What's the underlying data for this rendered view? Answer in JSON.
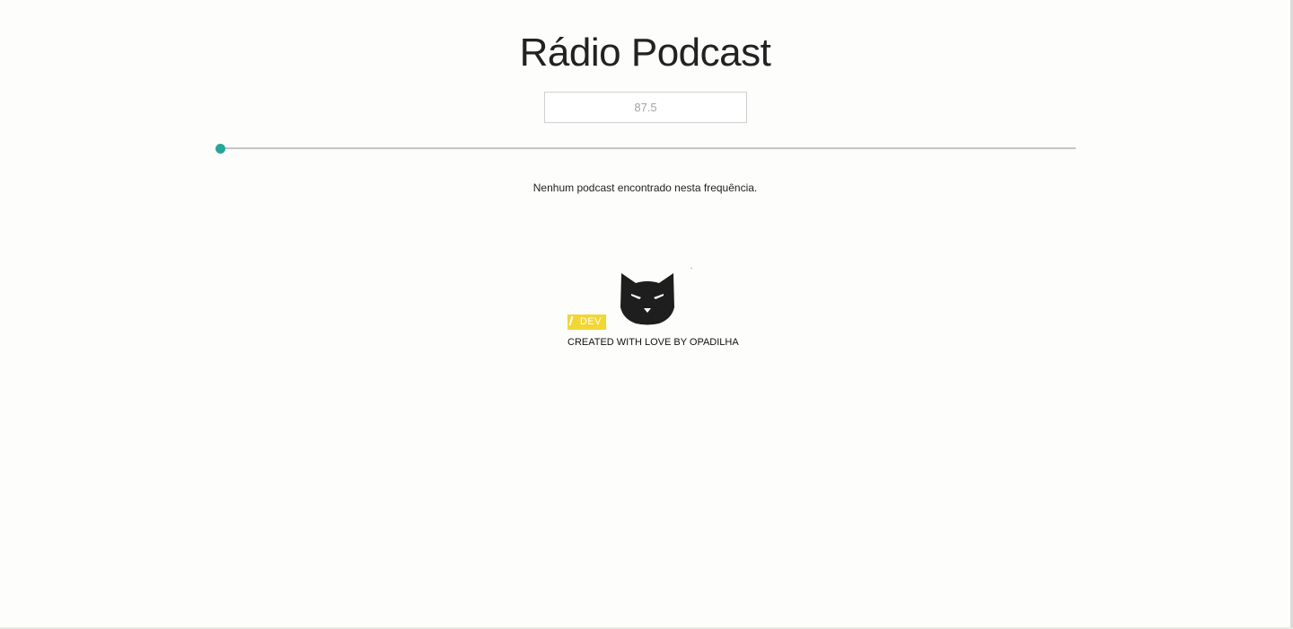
{
  "page": {
    "title": "Rádio Podcast"
  },
  "frequency": {
    "placeholder": "87.5",
    "value": ""
  },
  "slider": {
    "value_fraction": 0.0,
    "accent_color": "#26a69a",
    "track_color": "#c4c4c4"
  },
  "results": {
    "empty_message": "Nenhum podcast encontrado nesta frequência."
  },
  "footer": {
    "badge_text": "DEV",
    "badge_color": "#f2d634",
    "logo_icon": "cat-head-icon",
    "credit": "CREATED WITH LOVE BY OPADILHA"
  }
}
